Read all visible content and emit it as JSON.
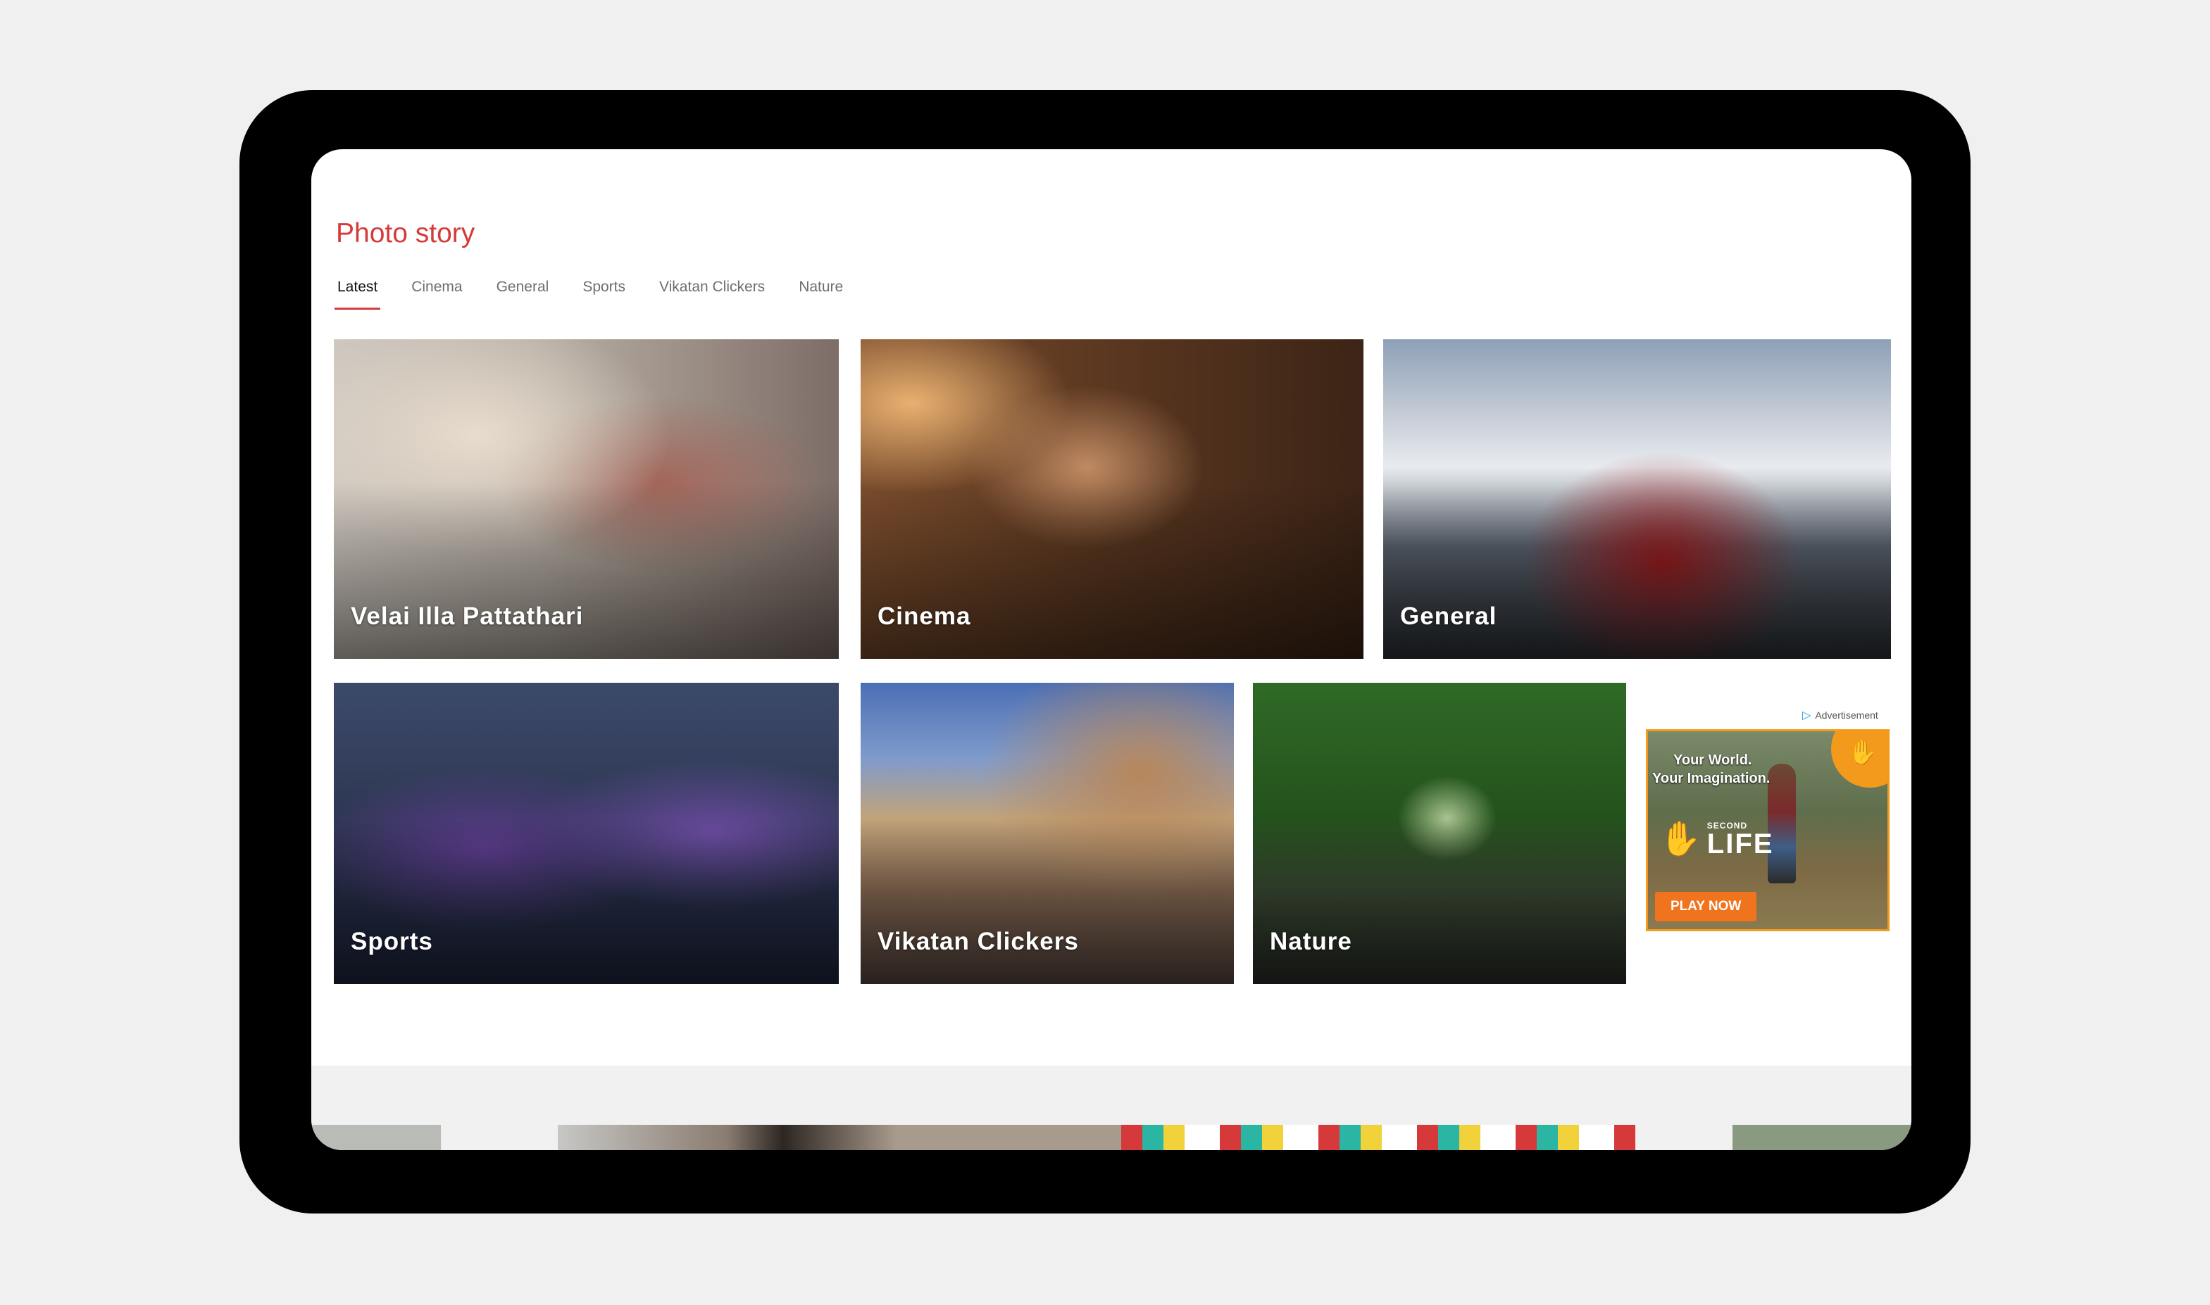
{
  "section_title": "Photo story",
  "tabs": [
    {
      "label": "Latest",
      "active": true
    },
    {
      "label": "Cinema",
      "active": false
    },
    {
      "label": "General",
      "active": false
    },
    {
      "label": "Sports",
      "active": false
    },
    {
      "label": "Vikatan Clickers",
      "active": false
    },
    {
      "label": "Nature",
      "active": false
    }
  ],
  "cards": [
    {
      "label": "Velai Illa Pattathari"
    },
    {
      "label": "Cinema"
    },
    {
      "label": "General"
    },
    {
      "label": "Sports"
    },
    {
      "label": "Vikatan Clickers"
    },
    {
      "label": "Nature"
    }
  ],
  "ad": {
    "tag": "Advertisement",
    "line1": "Your World.",
    "line2": "Your Imagination.",
    "logo_small": "SECOND",
    "logo_big": "LIFE",
    "cta": "PLAY NOW",
    "border_color": "#f39a1d"
  },
  "colors": {
    "accent": "#d63a3a"
  }
}
